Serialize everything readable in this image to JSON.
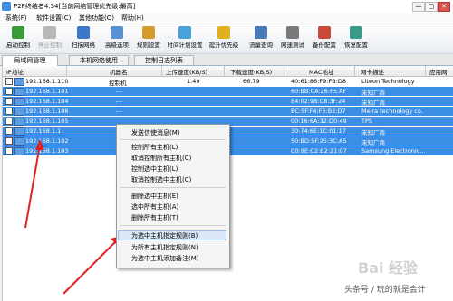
{
  "window": {
    "title": "P2P终结者4.34[当前网络管理优先级:最高]",
    "min": "—",
    "max": "▢",
    "close": "✕"
  },
  "menu": [
    "系统(F)",
    "软件设置(C)",
    "其他功能(O)",
    "帮助(H)"
  ],
  "toolbar": [
    {
      "label": "启动控制",
      "color": "#3a9b3a"
    },
    {
      "label": "停止控制",
      "color": "#b8b8b8",
      "disabled": true
    },
    {
      "label": "扫描网络",
      "color": "#3c78c8"
    },
    {
      "label": "高级选项",
      "color": "#5a8fd0"
    },
    {
      "label": "规则设置",
      "color": "#d49b2a"
    },
    {
      "label": "时间计划设置",
      "color": "#4aa0d8"
    },
    {
      "label": "提升优先级",
      "color": "#e0b020"
    },
    {
      "label": "流量查询",
      "color": "#4b79b8"
    },
    {
      "label": "网速测试",
      "color": "#7a7a7a"
    },
    {
      "label": "备份配置",
      "color": "#c84a3a"
    },
    {
      "label": "恢复配置",
      "color": "#3a9a8a"
    }
  ],
  "tabs": [
    "局域网管理",
    "本机网络使用",
    "控制日志列表"
  ],
  "columns": [
    "IP地址",
    "机器名",
    "上传速度(KB/S)",
    "下载速度(KB/S)",
    "MAC地址",
    "网卡描述",
    "应用网"
  ],
  "rows": [
    {
      "ip": "192.168.1.110",
      "name": "控制机",
      "up": "1.49",
      "down": "66.79",
      "mac": "40:61:86:F9:FB:D8",
      "nic": "Liteon Technology",
      "sel": false
    },
    {
      "ip": "192.168.1.101",
      "name": "---",
      "up": "",
      "down": "",
      "mac": "60:BB:CA:26:F5:AF",
      "nic": "未知厂商",
      "sel": true
    },
    {
      "ip": "192.168.1.104",
      "name": "---",
      "up": "",
      "down": "",
      "mac": "E4:02:9B:C8:3F:24",
      "nic": "未知厂商",
      "sel": true
    },
    {
      "ip": "192.168.1.106",
      "name": "---",
      "up": "",
      "down": "",
      "mac": "BC:5F:F4:F6:B2:D7",
      "nic": "Meira technology co.",
      "sel": true
    },
    {
      "ip": "192.168.1.105",
      "name": "",
      "up": "",
      "down": "",
      "mac": "00:16:6A:32:D0:49",
      "nic": "TPS",
      "sel": true
    },
    {
      "ip": "192.168.1.1",
      "name": "",
      "up": "",
      "down": "",
      "mac": "30:74:6E:1C:01:17",
      "nic": "未知厂商",
      "sel": true
    },
    {
      "ip": "192.168.1.102",
      "name": "",
      "up": "",
      "down": "",
      "mac": "50:BD:5F:25:3C:A5",
      "nic": "未知厂商",
      "sel": true
    },
    {
      "ip": "192.168.1.103",
      "name": "",
      "up": "",
      "down": "",
      "mac": "C0:9E:C2:B2:21:07",
      "nic": "Samsung Electronic...",
      "sel": true
    }
  ],
  "context_menu": [
    {
      "label": "发送信使消息(M)"
    },
    {
      "sep": true
    },
    {
      "label": "控制所有主机(L)"
    },
    {
      "label": "取消控制所有主机(C)"
    },
    {
      "label": "控制选中主机(L)"
    },
    {
      "label": "取消控制选中主机(C)"
    },
    {
      "sep": true
    },
    {
      "label": "删除选中主机(E)"
    },
    {
      "label": "选中所有主机(A)"
    },
    {
      "label": "删除所有主机(T)"
    },
    {
      "sep": true
    },
    {
      "label": "为选中主机指定规则(B)",
      "highlight": true
    },
    {
      "label": "为所有主机指定规则(N)"
    },
    {
      "label": "为选中主机添加备注(M)"
    }
  ],
  "watermark": "Bai 经验",
  "footer": "头条号 / 玩的就是会计"
}
